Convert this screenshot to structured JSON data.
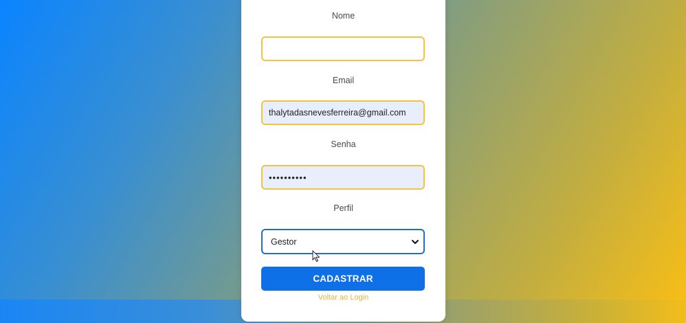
{
  "form": {
    "nome_label": "Nome",
    "nome_value": "",
    "email_label": "Email",
    "email_value": "thalytadasnevesferreira@gmail.com",
    "senha_label": "Senha",
    "senha_value": "••••••••••",
    "perfil_label": "Perfil",
    "perfil_selected": "Gestor",
    "submit_label": "CADASTRAR",
    "back_link_label": "Voltar ao Login"
  },
  "icons": {
    "select_arrow": "chevron-down-icon",
    "cursor": "mouse-cursor-icon"
  },
  "colors": {
    "input_border": "#f5c23e",
    "select_border": "#1f6fc8",
    "button_bg": "#0f6fe6",
    "link": "#e2b53a",
    "gradient_start": "#0a84ff",
    "gradient_end": "#fbbf14"
  }
}
